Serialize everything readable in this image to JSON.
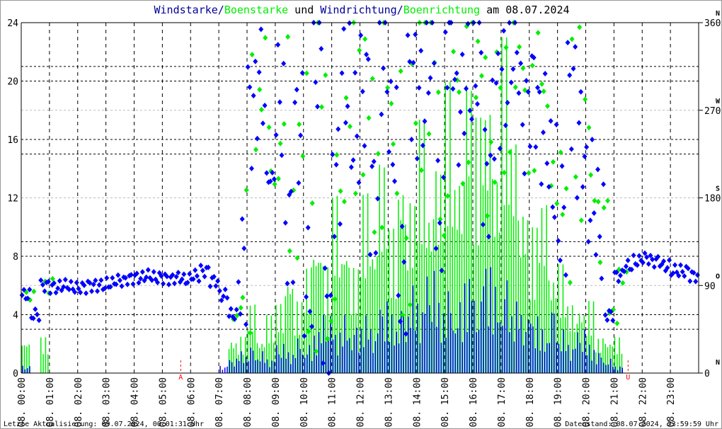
{
  "chart_data": {
    "type": "scatter",
    "title": {
      "part1": "Windstarke",
      "sep1": "/",
      "part2": "Boenstarke",
      "part3": " und ",
      "part4": "Windrichtung",
      "sep2": "/",
      "part5": "Boenrichtung",
      "part6": " am 08.07.2024"
    },
    "colors": {
      "wind": "#0000ff",
      "gust": "#00ee00",
      "title_blue": "#000099",
      "marker": "#ff0000"
    },
    "ylim_left": [
      0,
      24
    ],
    "yticks_left": [
      "0",
      "4",
      "8",
      "12",
      "16",
      "20",
      "24"
    ],
    "ylim_right": [
      0,
      360
    ],
    "yticks_right": [
      "0",
      "90",
      "180",
      "270",
      "360"
    ],
    "direction_labels": [
      "N",
      "O",
      "S",
      "W",
      "N"
    ],
    "xticks": [
      "08. 00:00",
      "08. 01:00",
      "08. 02:00",
      "08. 03:00",
      "08. 04:00",
      "08. 05:00",
      "08. 06:00",
      "08. 07:00",
      "08. 08:00",
      "08. 09:00",
      "08. 10:00",
      "08. 11:00",
      "08. 12:00",
      "08. 13:00",
      "08. 14:00",
      "08. 15:00",
      "08. 16:00",
      "08. 17:00",
      "08. 18:00",
      "08. 19:00",
      "08. 20:00",
      "08. 21:00",
      "08. 22:00",
      "08. 23:00"
    ],
    "sunrise": {
      "label": "A",
      "hour": 5.65
    },
    "sunset": {
      "label": "U",
      "hour": 21.5
    },
    "sample_interval_hours": 0.3333,
    "wind_direction_deg": [
      80,
      60,
      90,
      88,
      90,
      88,
      88,
      90,
      90,
      92,
      95,
      97,
      98,
      100,
      98,
      97,
      98,
      96,
      100,
      105,
      95,
      80,
      60,
      110,
      270,
      300,
      200,
      280,
      150,
      250,
      90,
      320,
      60,
      200,
      300,
      250,
      290,
      180,
      320,
      240,
      100,
      300,
      280,
      330,
      160,
      350,
      270,
      300,
      320,
      200,
      280,
      300,
      340,
      260,
      290,
      250,
      200,
      160,
      290,
      240,
      180,
      150,
      60,
      100,
      110,
      115,
      118,
      115,
      110,
      105,
      105,
      100
    ],
    "wind_speed_ms": [
      0.5,
      0,
      0,
      0,
      0,
      0,
      0,
      0,
      0,
      0,
      0,
      0,
      0,
      0,
      0,
      0,
      0,
      0,
      0,
      0,
      0,
      0.5,
      1,
      1.5,
      2,
      1.5,
      1,
      2,
      1.5,
      2.5,
      2,
      3,
      4,
      3,
      4,
      3.5,
      4,
      3,
      5,
      4,
      5,
      6,
      5,
      7,
      5,
      6,
      5,
      7,
      5,
      8,
      6,
      7,
      5,
      4,
      4,
      3,
      5,
      3,
      2,
      3,
      2,
      1.5,
      1,
      0.5,
      0,
      0,
      0,
      0,
      0,
      0,
      0,
      0
    ],
    "gust_speed_ms": [
      2.5,
      0,
      2.5,
      0,
      0,
      0,
      0,
      0,
      0,
      0,
      0,
      0,
      0,
      0,
      0,
      0,
      0,
      0,
      0,
      0,
      0,
      0,
      2.5,
      2.5,
      5,
      2.5,
      4,
      5,
      7.5,
      5,
      7.5,
      10,
      7.5,
      12.5,
      10,
      7.5,
      12.5,
      10,
      15,
      10,
      15,
      12.5,
      17.5,
      12.5,
      15,
      20,
      15,
      22,
      17.5,
      20,
      15,
      23,
      17.5,
      12.5,
      10,
      12.5,
      7.5,
      7.5,
      5,
      5,
      5,
      2.5,
      2.5,
      2.5,
      0,
      0,
      0,
      0,
      0,
      0,
      0,
      0
    ]
  },
  "footer": {
    "left": "Letzte Aktualisierung: 09.07.2024, 00:01:31 Uhr",
    "right": "Datenstand: 08.07.2024, 23:59:59 Uhr"
  }
}
